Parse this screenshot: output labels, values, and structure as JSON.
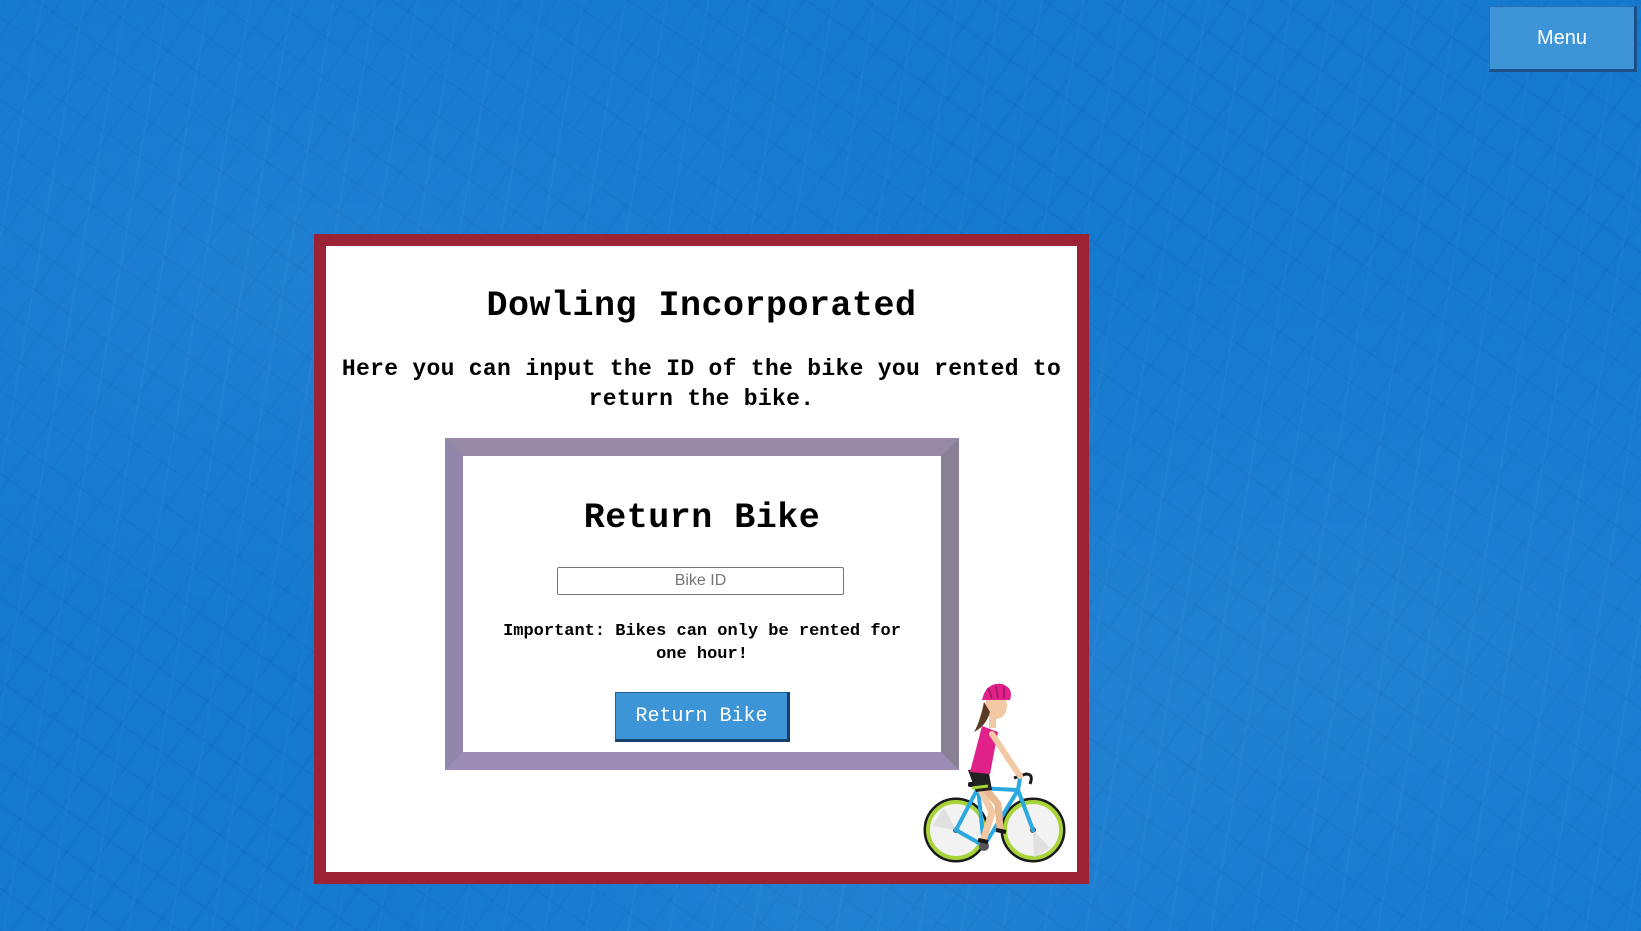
{
  "header": {
    "menu_label": "Menu"
  },
  "main": {
    "title": "Dowling Incorporated",
    "intro": "Here you can input the ID of the bike you rented to return the bike."
  },
  "form": {
    "title": "Return Bike",
    "bike_id": {
      "placeholder": "Bike ID",
      "value": ""
    },
    "notice": "Important: Bikes can only be rented for one hour!",
    "submit_label": "Return Bike"
  },
  "illustration": {
    "icon": "cyclist-illustration"
  },
  "colors": {
    "background": "#1479cf",
    "button": "#3d95d8",
    "outer_border": "#9b2335",
    "inner_border": "#968aa6",
    "helmet": "#e0218a",
    "bike_frame": "#2aa8e0",
    "tires": "#a8d43a"
  }
}
